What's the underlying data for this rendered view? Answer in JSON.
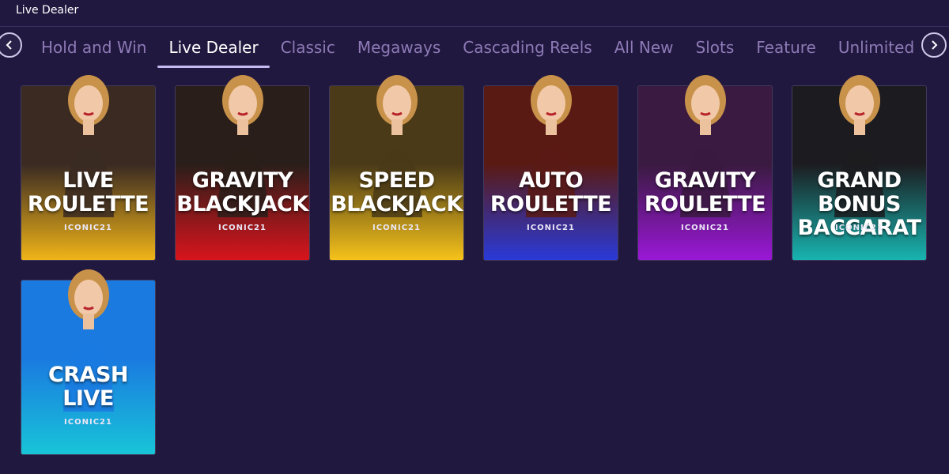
{
  "header": {
    "title": "Live Dealer"
  },
  "nav": {
    "prev_icon": "chevron-left-icon",
    "next_icon": "chevron-right-icon",
    "tabs": [
      {
        "label": "Hold and Win",
        "active": false
      },
      {
        "label": "Live Dealer",
        "active": true
      },
      {
        "label": "Classic",
        "active": false
      },
      {
        "label": "Megaways",
        "active": false
      },
      {
        "label": "Cascading Reels",
        "active": false
      },
      {
        "label": "All New",
        "active": false
      },
      {
        "label": "Slots",
        "active": false
      },
      {
        "label": "Feature",
        "active": false
      },
      {
        "label": "Unlimited Play",
        "active": false
      }
    ]
  },
  "colors": {
    "background": "#21183f",
    "tab_inactive": "#8d7ab6",
    "tab_active": "#ffffff"
  },
  "games": [
    {
      "title_line1": "LIVE",
      "title_line2": "ROULETTE",
      "provider": "ICONIC21",
      "theme_top": "#3a2a22",
      "theme_bottom": "#f0b418"
    },
    {
      "title_line1": "GRAVITY",
      "title_line2": "BLACKJACK",
      "provider": "ICONIC21",
      "theme_top": "#2a1e1a",
      "theme_bottom": "#d8141c"
    },
    {
      "title_line1": "SPEED",
      "title_line2": "BLACKJACK",
      "provider": "ICONIC21",
      "theme_top": "#4a3a18",
      "theme_bottom": "#f5c21a"
    },
    {
      "title_line1": "AUTO",
      "title_line2": "ROULETTE",
      "provider": "ICONIC21",
      "theme_top": "#5a1a14",
      "theme_bottom": "#2a3ad8"
    },
    {
      "title_line1": "GRAVITY",
      "title_line2": "ROULETTE",
      "provider": "ICONIC21",
      "theme_top": "#3a1a40",
      "theme_bottom": "#9a18d8"
    },
    {
      "title_line1": "GRAND BONUS",
      "title_line2": "BACCARAT",
      "provider": "ICONIC21",
      "theme_top": "#1c1c20",
      "theme_bottom": "#18b4b0"
    },
    {
      "title_line1": "CRASH",
      "title_line2": "LIVE",
      "provider": "ICONIC21",
      "theme_top": "#1a7ae0",
      "theme_bottom": "#18c4d8"
    }
  ]
}
